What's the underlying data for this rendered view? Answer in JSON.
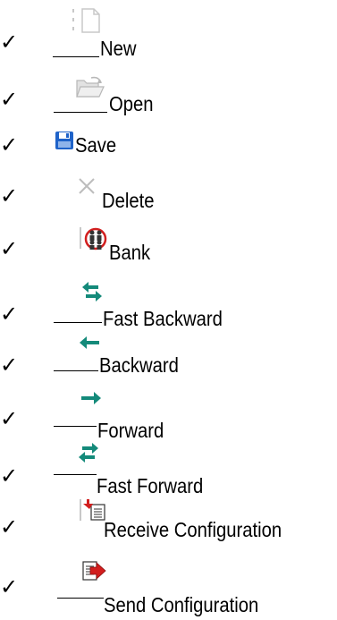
{
  "items": [
    {
      "check": "✓",
      "label": "New",
      "icon": "new-document-icon"
    },
    {
      "check": "✓",
      "label": "Open",
      "icon": "open-folder-icon"
    },
    {
      "check": "✓",
      "label": "Save",
      "icon": "floppy-disk-icon"
    },
    {
      "check": "✓",
      "label": "Delete",
      "icon": "delete-x-icon"
    },
    {
      "check": "✓",
      "label": "Bank",
      "icon": "bank-ring-icon"
    },
    {
      "check": "✓",
      "label": "Fast Backward",
      "icon": "fast-backward-arrows-icon"
    },
    {
      "check": "✓",
      "label": "Backward",
      "icon": "backward-arrow-icon"
    },
    {
      "check": "✓",
      "label": "Forward",
      "icon": "forward-arrow-icon"
    },
    {
      "check": "✓",
      "label": "Fast Forward",
      "icon": "fast-forward-arrows-icon"
    },
    {
      "check": "✓",
      "label": "Receive Configuration",
      "icon": "receive-configuration-icon"
    },
    {
      "check": "✓",
      "label": "Send Configuration",
      "icon": "send-configuration-icon"
    }
  ],
  "colors": {
    "text": "#000000",
    "teal_arrow": "#148a7a",
    "floppy_blue": "#1f63c9",
    "doc_gray": "#c8c8c8",
    "red_arrow": "#d21e1e"
  }
}
